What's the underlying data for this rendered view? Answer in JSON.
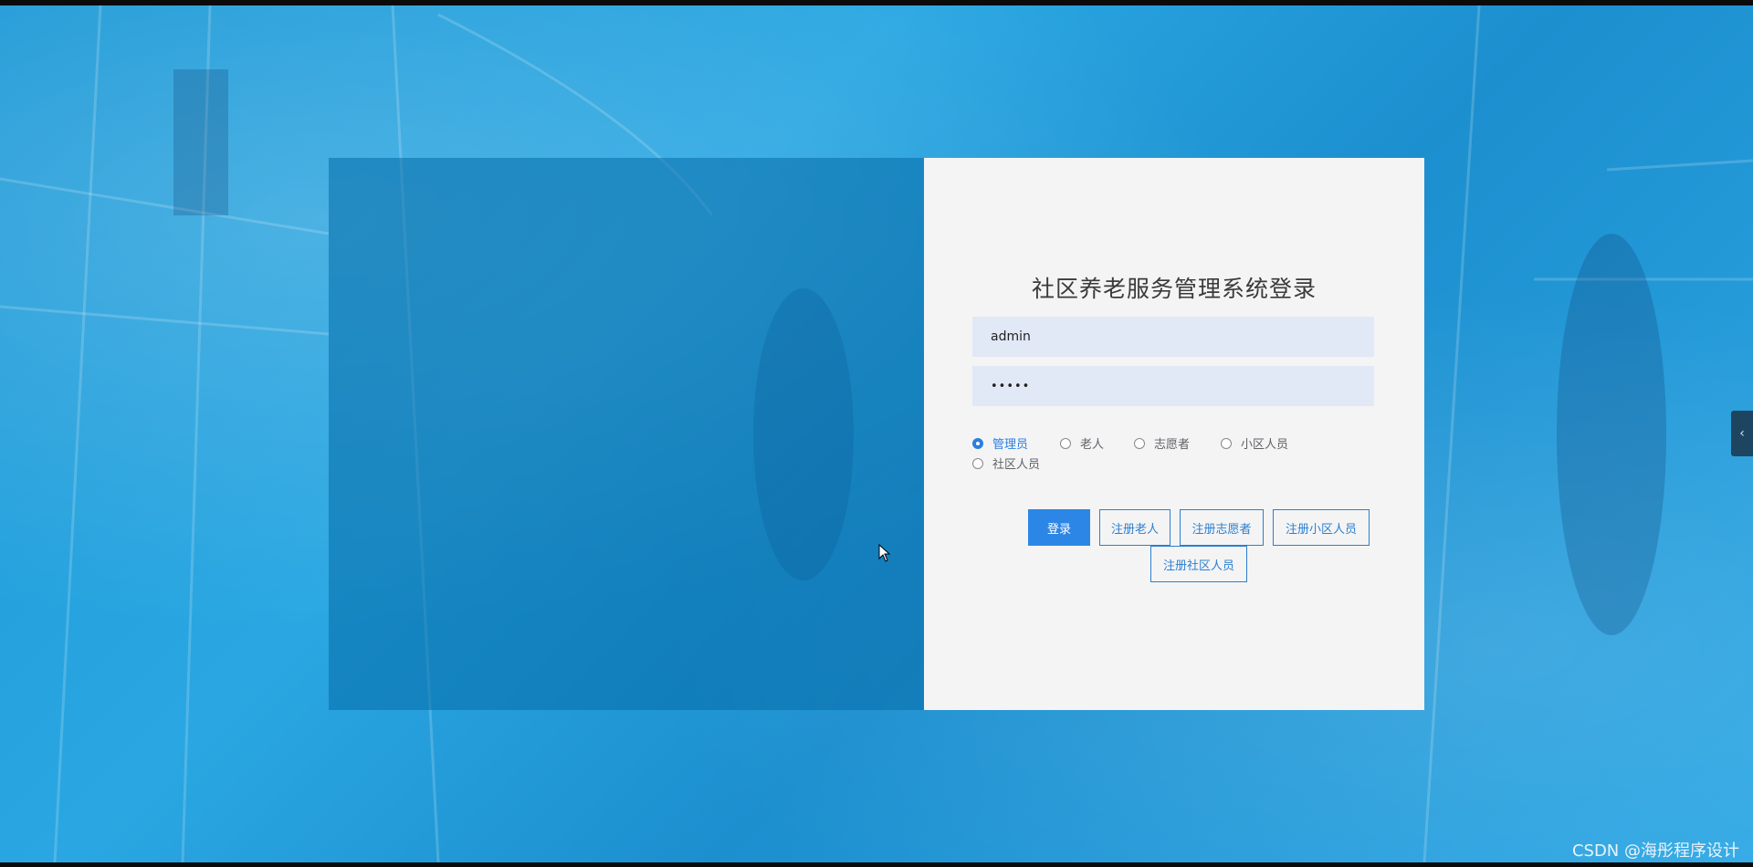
{
  "login": {
    "title": "社区养老服务管理系统登录",
    "username_value": "admin",
    "password_value": "•••••",
    "roles": [
      {
        "label": "管理员",
        "selected": true
      },
      {
        "label": "老人",
        "selected": false
      },
      {
        "label": "志愿者",
        "selected": false
      },
      {
        "label": "小区人员",
        "selected": false
      },
      {
        "label": "社区人员",
        "selected": false
      }
    ],
    "buttons": {
      "login": "登录",
      "register_elder": "注册老人",
      "register_volunteer": "注册志愿者",
      "register_resident": "注册小区人员",
      "register_community": "注册社区人员"
    }
  },
  "side_tab_icon": "chevron-left-icon",
  "watermark": "CSDN @海彤程序设计",
  "colors": {
    "primary": "#2c86e6",
    "field_bg": "#e1e8f6",
    "panel_bg": "#f4f4f5"
  }
}
